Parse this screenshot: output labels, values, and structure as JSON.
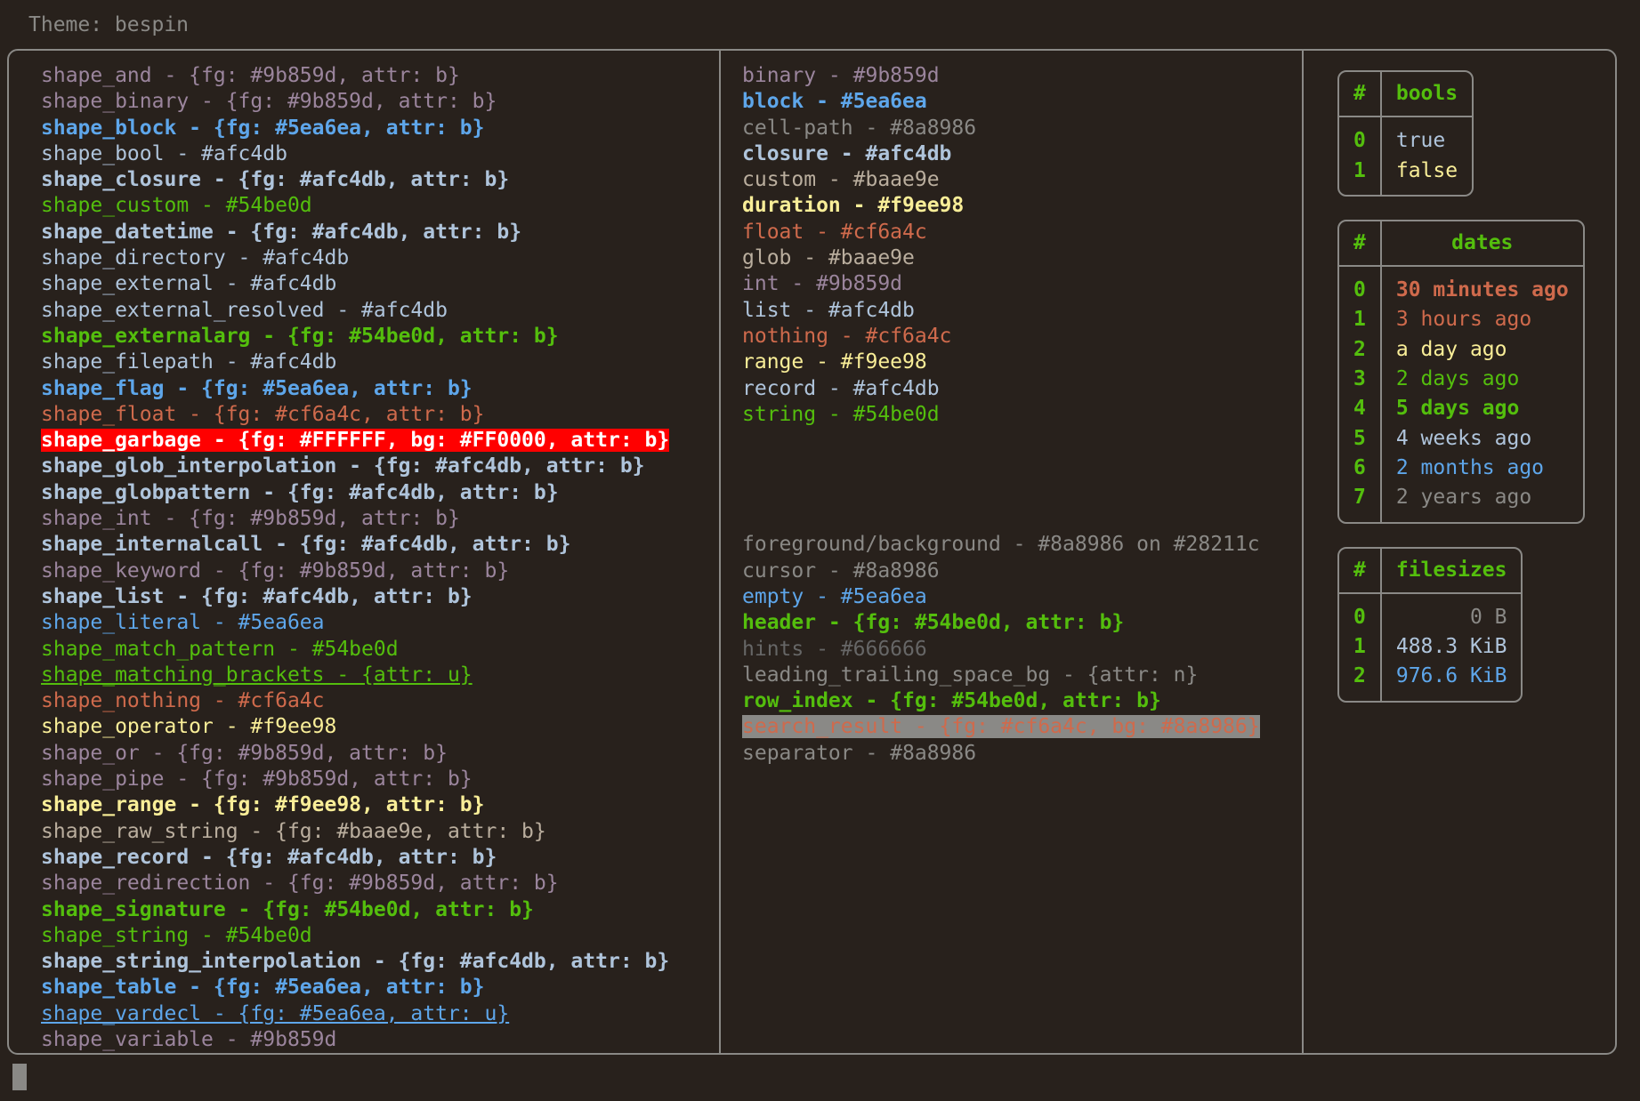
{
  "theme_label": "Theme: bespin",
  "palette": {
    "background": "#28211c",
    "foreground": "#8a8986",
    "border": "#8a8986",
    "purple": "#9b859d",
    "blue": "#5ea6ea",
    "lightblue": "#afc4db",
    "green": "#54be0d",
    "yellow": "#f9ee98",
    "orange": "#cf6a4c",
    "tan": "#baae9e",
    "grey": "#8a8986",
    "dim": "#666666",
    "white": "#FFFFFF",
    "red": "#FF0000"
  },
  "shapes": [
    {
      "text": "shape_and - {fg: #9b859d, attr: b}",
      "color": "#9b859d",
      "bold": false,
      "underline": false
    },
    {
      "text": "shape_binary - {fg: #9b859d, attr: b}",
      "color": "#9b859d",
      "bold": false,
      "underline": false
    },
    {
      "text": "shape_block - {fg: #5ea6ea, attr: b}",
      "color": "#5ea6ea",
      "bold": true,
      "underline": false
    },
    {
      "text": "shape_bool - #afc4db",
      "color": "#afc4db",
      "bold": false,
      "underline": false
    },
    {
      "text": "shape_closure - {fg: #afc4db, attr: b}",
      "color": "#afc4db",
      "bold": true,
      "underline": false
    },
    {
      "text": "shape_custom - #54be0d",
      "color": "#54be0d",
      "bold": false,
      "underline": false
    },
    {
      "text": "shape_datetime - {fg: #afc4db, attr: b}",
      "color": "#afc4db",
      "bold": true,
      "underline": false
    },
    {
      "text": "shape_directory - #afc4db",
      "color": "#afc4db",
      "bold": false,
      "underline": false
    },
    {
      "text": "shape_external - #afc4db",
      "color": "#afc4db",
      "bold": false,
      "underline": false
    },
    {
      "text": "shape_external_resolved - #afc4db",
      "color": "#afc4db",
      "bold": false,
      "underline": false
    },
    {
      "text": "shape_externalarg - {fg: #54be0d, attr: b}",
      "color": "#54be0d",
      "bold": true,
      "underline": false
    },
    {
      "text": "shape_filepath - #afc4db",
      "color": "#afc4db",
      "bold": false,
      "underline": false
    },
    {
      "text": "shape_flag - {fg: #5ea6ea, attr: b}",
      "color": "#5ea6ea",
      "bold": true,
      "underline": false
    },
    {
      "text": "shape_float - {fg: #cf6a4c, attr: b}",
      "color": "#cf6a4c",
      "bold": false,
      "underline": false
    },
    {
      "text": "shape_garbage - {fg: #FFFFFF, bg: #FF0000, attr: b}",
      "color": "#FFFFFF",
      "bg": "#FF0000",
      "bold": true,
      "underline": false
    },
    {
      "text": "shape_glob_interpolation - {fg: #afc4db, attr: b}",
      "color": "#afc4db",
      "bold": true,
      "underline": false
    },
    {
      "text": "shape_globpattern - {fg: #afc4db, attr: b}",
      "color": "#afc4db",
      "bold": true,
      "underline": false
    },
    {
      "text": "shape_int - {fg: #9b859d, attr: b}",
      "color": "#9b859d",
      "bold": false,
      "underline": false
    },
    {
      "text": "shape_internalcall - {fg: #afc4db, attr: b}",
      "color": "#afc4db",
      "bold": true,
      "underline": false
    },
    {
      "text": "shape_keyword - {fg: #9b859d, attr: b}",
      "color": "#9b859d",
      "bold": false,
      "underline": false
    },
    {
      "text": "shape_list - {fg: #afc4db, attr: b}",
      "color": "#afc4db",
      "bold": true,
      "underline": false
    },
    {
      "text": "shape_literal - #5ea6ea",
      "color": "#5ea6ea",
      "bold": false,
      "underline": false
    },
    {
      "text": "shape_match_pattern - #54be0d",
      "color": "#54be0d",
      "bold": false,
      "underline": false
    },
    {
      "text": "shape_matching_brackets - {attr: u}",
      "color": "#54be0d",
      "bold": false,
      "underline": true
    },
    {
      "text": "shape_nothing - #cf6a4c",
      "color": "#cf6a4c",
      "bold": false,
      "underline": false
    },
    {
      "text": "shape_operator - #f9ee98",
      "color": "#f9ee98",
      "bold": false,
      "underline": false
    },
    {
      "text": "shape_or - {fg: #9b859d, attr: b}",
      "color": "#9b859d",
      "bold": false,
      "underline": false
    },
    {
      "text": "shape_pipe - {fg: #9b859d, attr: b}",
      "color": "#9b859d",
      "bold": false,
      "underline": false
    },
    {
      "text": "shape_range - {fg: #f9ee98, attr: b}",
      "color": "#f9ee98",
      "bold": true,
      "underline": false
    },
    {
      "text": "shape_raw_string - {fg: #baae9e, attr: b}",
      "color": "#baae9e",
      "bold": false,
      "underline": false
    },
    {
      "text": "shape_record - {fg: #afc4db, attr: b}",
      "color": "#afc4db",
      "bold": true,
      "underline": false
    },
    {
      "text": "shape_redirection - {fg: #9b859d, attr: b}",
      "color": "#9b859d",
      "bold": false,
      "underline": false
    },
    {
      "text": "shape_signature - {fg: #54be0d, attr: b}",
      "color": "#54be0d",
      "bold": true,
      "underline": false
    },
    {
      "text": "shape_string - #54be0d",
      "color": "#54be0d",
      "bold": false,
      "underline": false
    },
    {
      "text": "shape_string_interpolation - {fg: #afc4db, attr: b}",
      "color": "#afc4db",
      "bold": true,
      "underline": false
    },
    {
      "text": "shape_table - {fg: #5ea6ea, attr: b}",
      "color": "#5ea6ea",
      "bold": true,
      "underline": false
    },
    {
      "text": "shape_vardecl - {fg: #5ea6ea, attr: u}",
      "color": "#5ea6ea",
      "bold": false,
      "underline": true
    },
    {
      "text": "shape_variable - #9b859d",
      "color": "#9b859d",
      "bold": false,
      "underline": false
    }
  ],
  "types": [
    {
      "text": "binary - #9b859d",
      "color": "#9b859d",
      "bold": false
    },
    {
      "text": "block - #5ea6ea",
      "color": "#5ea6ea",
      "bold": true
    },
    {
      "text": "cell-path - #8a8986",
      "color": "#8a8986",
      "bold": false
    },
    {
      "text": "closure - #afc4db",
      "color": "#afc4db",
      "bold": true
    },
    {
      "text": "custom - #baae9e",
      "color": "#baae9e",
      "bold": false
    },
    {
      "text": "duration - #f9ee98",
      "color": "#f9ee98",
      "bold": true
    },
    {
      "text": "float - #cf6a4c",
      "color": "#cf6a4c",
      "bold": false
    },
    {
      "text": "glob - #baae9e",
      "color": "#baae9e",
      "bold": false
    },
    {
      "text": "int - #9b859d",
      "color": "#9b859d",
      "bold": false
    },
    {
      "text": "list - #afc4db",
      "color": "#afc4db",
      "bold": false
    },
    {
      "text": "nothing - #cf6a4c",
      "color": "#cf6a4c",
      "bold": false
    },
    {
      "text": "range - #f9ee98",
      "color": "#f9ee98",
      "bold": false
    },
    {
      "text": "record - #afc4db",
      "color": "#afc4db",
      "bold": false
    },
    {
      "text": "string - #54be0d",
      "color": "#54be0d",
      "bold": false
    }
  ],
  "ui": [
    {
      "text": "foreground/background - #8a8986 on #28211c",
      "color": "#8a8986",
      "bold": false
    },
    {
      "text": "cursor - #8a8986",
      "color": "#8a8986",
      "bold": false
    },
    {
      "text": "empty - #5ea6ea",
      "color": "#5ea6ea",
      "bold": false
    },
    {
      "text": "header - {fg: #54be0d, attr: b}",
      "color": "#54be0d",
      "bold": true
    },
    {
      "text": "hints - #666666",
      "color": "#666666",
      "bold": false
    },
    {
      "text": "leading_trailing_space_bg - {attr: n}",
      "color": "#8a8986",
      "bold": false
    },
    {
      "text": "row_index - {fg: #54be0d, attr: b}",
      "color": "#54be0d",
      "bold": true
    },
    {
      "text": "search_result - {fg: #cf6a4c, bg: #8a8986}",
      "color": "#cf6a4c",
      "bg": "#8a8986",
      "bold": false
    },
    {
      "text": "separator - #8a8986",
      "color": "#8a8986",
      "bold": false
    }
  ],
  "tables": [
    {
      "name": "bools",
      "index_header": "#",
      "value_header": "bools",
      "align_right": false,
      "rows": [
        {
          "index": "0",
          "value": "true",
          "color": "#afc4db",
          "bold": false
        },
        {
          "index": "1",
          "value": "false",
          "color": "#f9ee98",
          "bold": false
        }
      ]
    },
    {
      "name": "dates",
      "index_header": "#",
      "value_header": "dates",
      "align_right": false,
      "rows": [
        {
          "index": "0",
          "value": "30 minutes ago",
          "color": "#cf6a4c",
          "bold": true
        },
        {
          "index": "1",
          "value": "3 hours ago",
          "color": "#cf6a4c",
          "bold": false
        },
        {
          "index": "2",
          "value": "a day ago",
          "color": "#f9ee98",
          "bold": false
        },
        {
          "index": "3",
          "value": "2 days ago",
          "color": "#54be0d",
          "bold": false
        },
        {
          "index": "4",
          "value": "5 days ago",
          "color": "#54be0d",
          "bold": true
        },
        {
          "index": "5",
          "value": "4 weeks ago",
          "color": "#afc4db",
          "bold": false
        },
        {
          "index": "6",
          "value": "2 months ago",
          "color": "#5ea6ea",
          "bold": false
        },
        {
          "index": "7",
          "value": "2 years ago",
          "color": "#8a8986",
          "bold": false
        }
      ]
    },
    {
      "name": "filesizes",
      "index_header": "#",
      "value_header": "filesizes",
      "align_right": true,
      "rows": [
        {
          "index": "0",
          "value": "0 B",
          "color": "#8a8986",
          "bold": false
        },
        {
          "index": "1",
          "value": "488.3 KiB",
          "color": "#afc4db",
          "bold": false
        },
        {
          "index": "2",
          "value": "976.6 KiB",
          "color": "#5ea6ea",
          "bold": false
        }
      ]
    }
  ]
}
